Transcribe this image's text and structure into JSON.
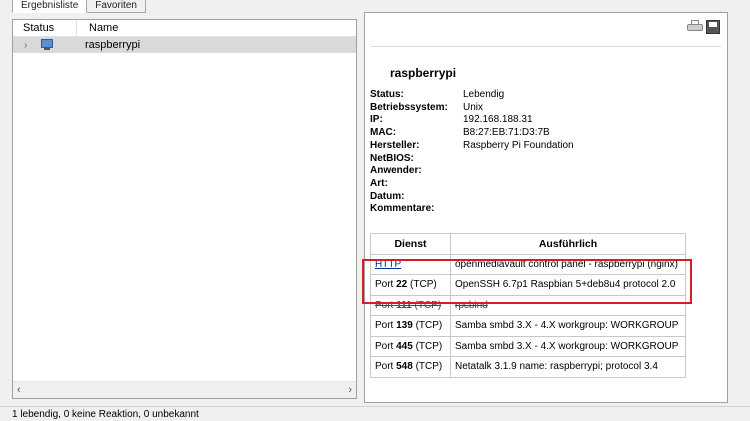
{
  "tabs": [
    "Ergebnisliste",
    "Favoriten"
  ],
  "results_list": {
    "columns": {
      "status": "Status",
      "name": "Name"
    },
    "rows": [
      {
        "expander": "›",
        "name": "raspberrypi"
      }
    ],
    "scroll_left": "‹",
    "scroll_right": "›"
  },
  "detail": {
    "host_title": "raspberrypi",
    "fields": [
      {
        "key": "Status:",
        "value": "Lebendig"
      },
      {
        "key": "Betriebssystem:",
        "value": "Unix"
      },
      {
        "key": "IP:",
        "value": "192.168.188.31"
      },
      {
        "key": "MAC:",
        "value": "B8:27:EB:71:D3:7B"
      },
      {
        "key": "Hersteller:",
        "value": "Raspberry Pi Foundation"
      },
      {
        "key": "NetBIOS:",
        "value": ""
      },
      {
        "key": "Anwender:",
        "value": ""
      },
      {
        "key": "Art:",
        "value": ""
      },
      {
        "key": "Datum:",
        "value": ""
      },
      {
        "key": "Kommentare:",
        "value": ""
      }
    ],
    "services": {
      "headers": {
        "service": "Dienst",
        "detail": "Ausführlich"
      },
      "rows": [
        {
          "service": "HTTP",
          "detail": "openmediavault control panel - raspberrypi (nginx)"
        },
        {
          "prefix": "Port",
          "port": "22",
          "proto": "(TCP)",
          "detail": "OpenSSH 6.7p1 Raspbian 5+deb8u4 protocol 2.0"
        },
        {
          "prefix": "Port",
          "port": "111",
          "proto": "(TCP)",
          "detail": "rpcbind"
        },
        {
          "prefix": "Port",
          "port": "139",
          "proto": "(TCP)",
          "detail": "Samba smbd 3.X - 4.X workgroup: WORKGROUP"
        },
        {
          "prefix": "Port",
          "port": "445",
          "proto": "(TCP)",
          "detail": "Samba smbd 3.X - 4.X workgroup: WORKGROUP"
        },
        {
          "prefix": "Port",
          "port": "548",
          "proto": "(TCP)",
          "detail": "Netatalk 3.1.9 name: raspberrypi; protocol 3.4"
        }
      ]
    }
  },
  "status_bar": "1 lebendig, 0 keine Reaktion, 0 unbekannt",
  "colors": {
    "highlight_border": "#d21f2b",
    "link": "#0033aa",
    "selected_row": "#d9d9d9"
  }
}
